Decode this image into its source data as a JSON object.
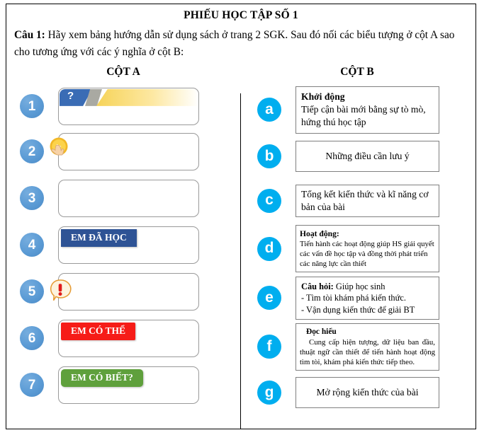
{
  "document": {
    "title": "PHIẾU HỌC TẬP SỐ 1",
    "question_label": "Câu 1:",
    "question_text": " Hãy xem bảng hướng dẫn sử dụng sách ở trang 2 SGK. Sau đó nối các biểu tượng ở cột A sao cho tương ứng với các ý nghĩa ở cột B:"
  },
  "columns": {
    "a_heading": "CỘT A",
    "b_heading": "CỘT B"
  },
  "column_a": {
    "items": [
      {
        "number": "1",
        "icon": "question-tab-icon",
        "label": "?"
      },
      {
        "number": "2",
        "icon": "hand-pointer-coin-icon",
        "label": ""
      },
      {
        "number": "3",
        "icon": "none",
        "label": ""
      },
      {
        "number": "4",
        "icon": "ribbon-blue",
        "label": "EM ĐÃ HỌC"
      },
      {
        "number": "5",
        "icon": "exclamation-bubble-icon",
        "label": "!"
      },
      {
        "number": "6",
        "icon": "ribbon-red",
        "label": "EM CÓ THỂ"
      },
      {
        "number": "7",
        "icon": "ribbon-green",
        "label": "EM CÓ BIẾT?"
      }
    ]
  },
  "column_b": {
    "items": [
      {
        "letter": "a",
        "title": "Khởi động",
        "lines": [
          "Tiếp cận bài mới bằng sự tò mò, hứng thú học tập"
        ],
        "style": "justified"
      },
      {
        "letter": "b",
        "title": "",
        "lines": [
          "Những điều cần lưu ý"
        ],
        "style": "centered"
      },
      {
        "letter": "c",
        "title": "",
        "lines": [
          "Tổng kết kiến thức và kĩ năng cơ bản của bài"
        ],
        "style": "left"
      },
      {
        "letter": "d",
        "title": "Hoạt động:",
        "lines": [
          "Tiến hành các hoạt động giúp HS giải quyết các vấn đề học tập và đồng thời phát triển các năng lực cần thiết"
        ],
        "style": "small"
      },
      {
        "letter": "e",
        "title": "Câu hỏi:",
        "lines": [
          " Giúp học sinh",
          "- Tìm tòi khám phá kiến thức.",
          "- Vận dụng kiến thức để giải BT"
        ],
        "style": "left"
      },
      {
        "letter": "f",
        "title": "Đọc hiểu",
        "lines": [
          "Cung cấp hiện tượng, dữ liệu ban đầu, thuật ngữ cần thiết để tiến hành hoạt động tìm tòi, khám phá kiến thức tiếp theo."
        ],
        "style": "small-indent"
      },
      {
        "letter": "g",
        "title": "",
        "lines": [
          "Mở rộng kiến thức của bài"
        ],
        "style": "centered"
      }
    ]
  },
  "colors": {
    "number_badge": "#5b9bd5",
    "letter_badge": "#00aeef",
    "ribbon_blue": "#2e5395",
    "ribbon_red": "#f61c18",
    "ribbon_green": "#5fa03c",
    "ribbon_tail": "#fcd34b",
    "box_border": "#808080",
    "card_border": "#9a9a9a"
  }
}
